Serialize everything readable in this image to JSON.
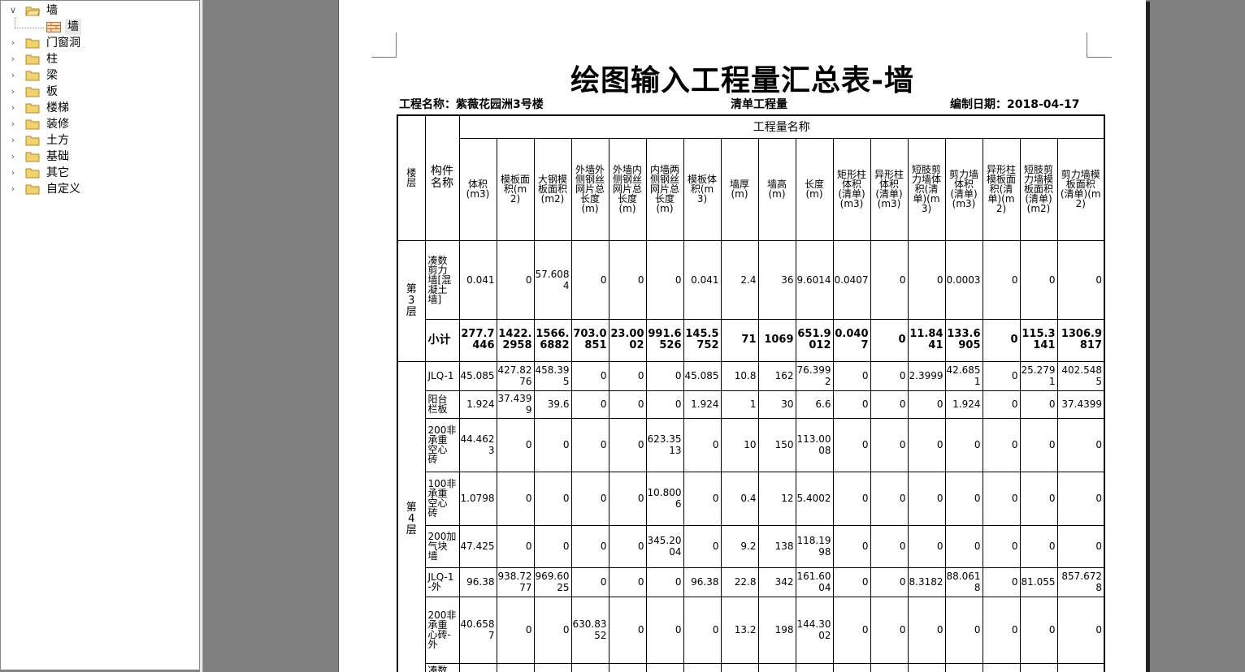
{
  "tree": {
    "root": {
      "label": "墙",
      "expanded": true,
      "child": {
        "label": "墙"
      }
    },
    "items": [
      {
        "label": "门窗洞"
      },
      {
        "label": "柱"
      },
      {
        "label": "梁"
      },
      {
        "label": "板"
      },
      {
        "label": "楼梯"
      },
      {
        "label": "装修"
      },
      {
        "label": "土方"
      },
      {
        "label": "基础"
      },
      {
        "label": "其它"
      },
      {
        "label": "自定义"
      }
    ]
  },
  "report": {
    "title": "绘图输入工程量汇总表-墙",
    "project_label": "工程名称：紫薇花园洲3号楼",
    "type_label": "清单工程量",
    "date_label": "编制日期：2018-04-17",
    "group_header": "工程量名称",
    "col_floor": "楼层",
    "col_component": "构件名称",
    "columns": [
      "体积(m3)",
      "模板面积(m2)",
      "大钢模板面积(m2)",
      "外墙外侧钢丝网片总长度(m)",
      "外墙内侧钢丝网片总长度(m)",
      "内墙两侧钢丝网片总长度(m)",
      "模板体积(m3)",
      "墙厚(m)",
      "墙高(m)",
      "长度(m)",
      "矩形柱体积(清单)(m3)",
      "异形柱体积(清单)(m3)",
      "短肢剪力墙体积(清单)(m3)",
      "剪力墙体积(清单)(m3)",
      "异形柱模板面积(清单)(m2)",
      "短肢剪力墙模板面积(清单)(m2)",
      "剪力墙模板面积(清单)(m2)"
    ],
    "floor3": {
      "label": "第3层",
      "rows": [
        {
          "name": "剪力墙[凝土墙]",
          "name_display": "凑数剪力墙[混凝土墙]",
          "cells": [
            "0.041",
            "0",
            "57.6084",
            "0",
            "0",
            "0",
            "0.041",
            "2.4",
            "36",
            "9.6014",
            "0.0407",
            "0",
            "0",
            "0.0003",
            "0",
            "0",
            "0"
          ]
        }
      ],
      "subtotal": {
        "name": "小计",
        "cells": [
          "277.7446",
          "1422.2958",
          "1566.6882",
          "703.0851",
          "23.0002",
          "991.6526",
          "145.5752",
          "71",
          "1069",
          "651.9012",
          "0.0407",
          "0",
          "11.8441",
          "133.6905",
          "0",
          "115.3141",
          "1306.9817"
        ]
      }
    },
    "floor4": {
      "label": "第4层",
      "rows": [
        {
          "name": "JLQ-1",
          "cells": [
            "45.085",
            "427.8276",
            "458.395",
            "0",
            "0",
            "0",
            "45.085",
            "10.8",
            "162",
            "76.3992",
            "0",
            "0",
            "2.3999",
            "42.6851",
            "0",
            "25.2791",
            "402.5485"
          ]
        },
        {
          "name": "阳台栏板",
          "cells": [
            "1.924",
            "37.4399",
            "39.6",
            "0",
            "0",
            "0",
            "1.924",
            "1",
            "30",
            "6.6",
            "0",
            "0",
            "0",
            "1.924",
            "0",
            "0",
            "37.4399"
          ]
        },
        {
          "name": "200非承重空心砖",
          "cells": [
            "44.4623",
            "0",
            "0",
            "0",
            "0",
            "623.3513",
            "0",
            "10",
            "150",
            "113.0008",
            "0",
            "0",
            "0",
            "0",
            "0",
            "0",
            "0"
          ]
        },
        {
          "name": "100非承重空心砖",
          "cells": [
            "1.0798",
            "0",
            "0",
            "0",
            "0",
            "10.8006",
            "0",
            "0.4",
            "12",
            "5.4002",
            "0",
            "0",
            "0",
            "0",
            "0",
            "0",
            "0"
          ]
        },
        {
          "name": "200加气块墙",
          "cells": [
            "47.425",
            "0",
            "0",
            "0",
            "0",
            "345.2004",
            "0",
            "9.2",
            "138",
            "118.1998",
            "0",
            "0",
            "0",
            "0",
            "0",
            "0",
            "0"
          ]
        },
        {
          "name": "JLQ-1-外",
          "cells": [
            "96.38",
            "938.7277",
            "969.6025",
            "0",
            "0",
            "0",
            "96.38",
            "22.8",
            "342",
            "161.6004",
            "0",
            "0",
            "8.3182",
            "88.0618",
            "0",
            "81.055",
            "857.6728"
          ]
        },
        {
          "name": "200非承重心砖-外",
          "cells": [
            "40.6587",
            "0",
            "0",
            "630.8352",
            "0",
            "0",
            "0",
            "13.2",
            "198",
            "144.3002",
            "0",
            "0",
            "0",
            "0",
            "0",
            "0",
            "0"
          ]
        }
      ]
    },
    "partial_row_name": "凑数"
  }
}
